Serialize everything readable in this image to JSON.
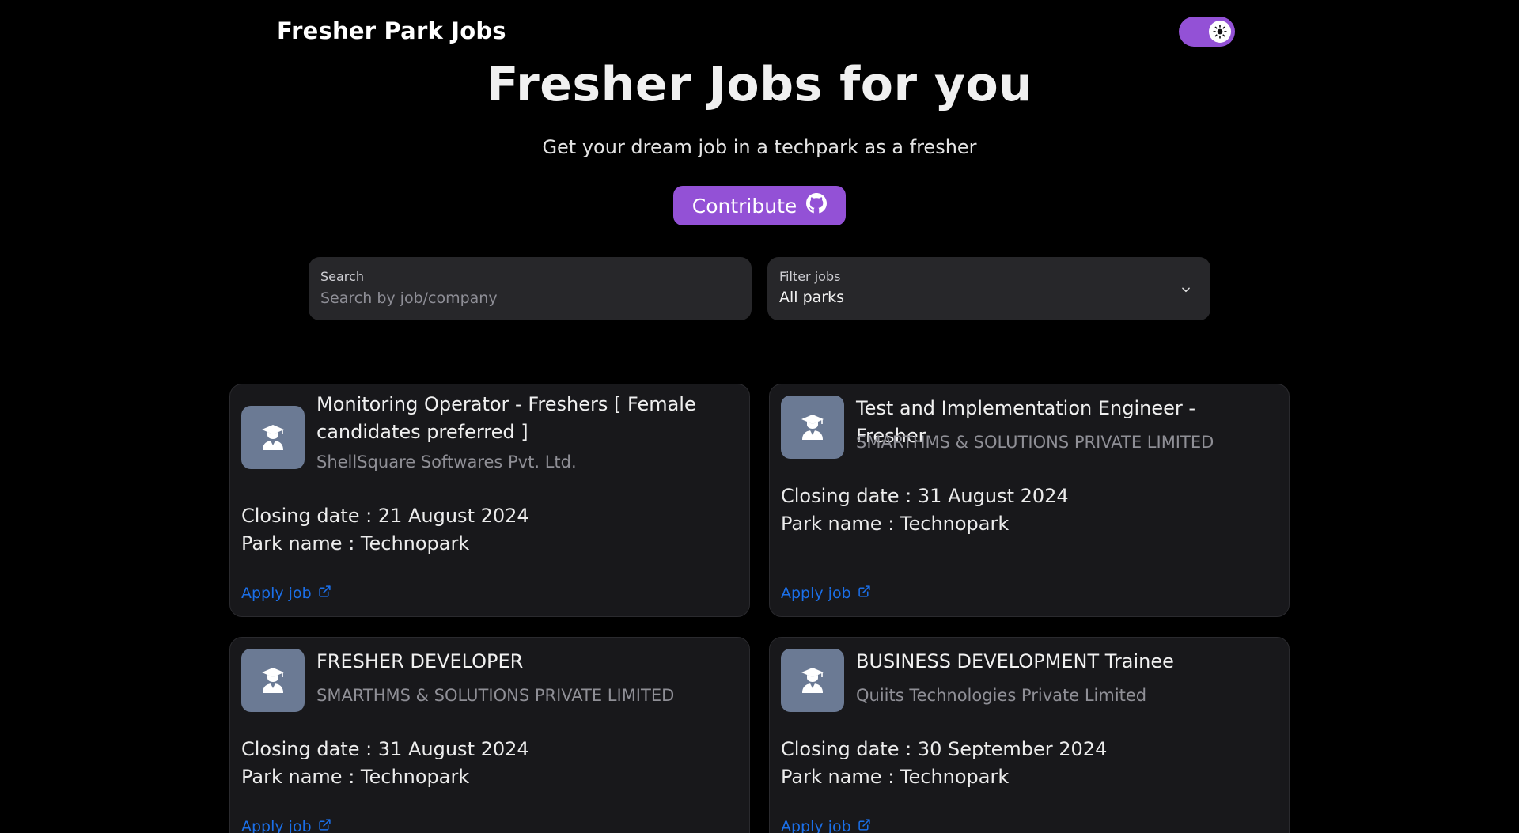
{
  "header": {
    "brand": "Fresher Park Jobs",
    "theme_toggle_icon": "sun-icon"
  },
  "hero": {
    "title": "Fresher Jobs for you",
    "subtitle": "Get your dream job in a techpark as a fresher",
    "contribute_label": "Contribute",
    "contribute_icon": "github-icon"
  },
  "search": {
    "label": "Search",
    "placeholder": "Search by job/company",
    "value": ""
  },
  "filter": {
    "label": "Filter jobs",
    "selected": "All parks"
  },
  "jobs": [
    {
      "title": "Monitoring Operator - Freshers [ Female candidates preferred ]",
      "company": "ShellSquare Softwares Pvt. Ltd.",
      "closing": "Closing date : 21 August 2024",
      "park": "Park name : Technopark",
      "apply": "Apply job"
    },
    {
      "title": "Test and Implementation Engineer - Fresher",
      "company": "SMARTHMS & SOLUTIONS PRIVATE LIMITED",
      "closing": "Closing date : 31 August 2024",
      "park": "Park name : Technopark",
      "apply": "Apply job"
    },
    {
      "title": "FRESHER DEVELOPER",
      "company": "SMARTHMS & SOLUTIONS PRIVATE LIMITED",
      "closing": "Closing date : 31 August 2024",
      "park": "Park name : Technopark",
      "apply": "Apply job"
    },
    {
      "title": "BUSINESS DEVELOPMENT Trainee",
      "company": "Quiits Technologies Private Limited",
      "closing": "Closing date : 30 September 2024",
      "park": "Park name : Technopark",
      "apply": "Apply job"
    }
  ],
  "colors": {
    "accent": "#9351d6",
    "link": "#1b6fe8",
    "card_bg": "#18181b",
    "field_bg": "#27272a",
    "logo_bg": "#6b7a94"
  }
}
